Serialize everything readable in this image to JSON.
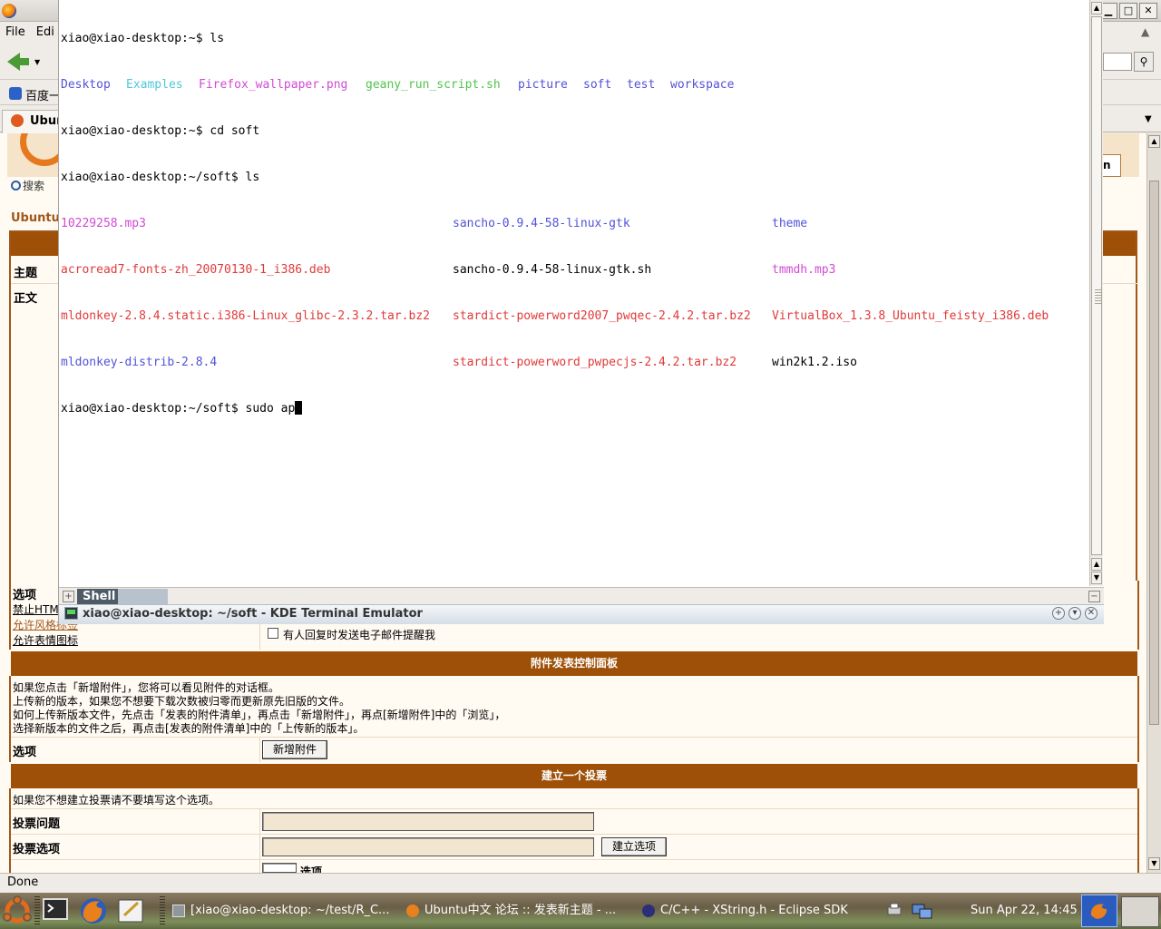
{
  "firefox": {
    "menu": {
      "file": "File",
      "edit": "Edi"
    },
    "bookmark": "百度一",
    "tab_title": "Ubun",
    "search_link": "搜索",
    "banner_tab": "n",
    "forum_title": "Ubuntu",
    "status": "Done",
    "form": {
      "subject_label": "主题",
      "body_label": "正文",
      "options_label": "选项",
      "opt_disable_html": "禁止HTM",
      "opt_allow_bbcode": "允许风格标签",
      "opt_allow_smilies": "允许表情图标",
      "notify_label": "有人回复时发送电子邮件提醒我",
      "attach_header": "附件发表控制面板",
      "attach_help": [
        "如果您点击「新增附件」，您将可以看见附件的对话框。",
        "上传新的版本，如果您不想要下载次数被归零而更新原先旧版的文件。",
        "如何上传新版本文件，先点击「发表的附件清单」，再点击「新增附件」，再点[新增附件]中的「浏览」，",
        "选择新版本的文件之后，再点击[发表的附件清单]中的「上传新的版本」。"
      ],
      "attach_options_label": "选项",
      "add_attachment_button": "新增附件",
      "poll_header": "建立一个投票",
      "poll_help": "如果您不想建立投票请不要填写这个选项。",
      "poll_question_label": "投票问题",
      "poll_option_label": "投票选项",
      "add_option_button": "建立选项",
      "poll_duration_suffix": "选项"
    }
  },
  "konsole": {
    "title": "xiao@xiao-desktop: ~/soft - KDE Terminal Emulator",
    "tab_label": "Shell",
    "terminal": {
      "prompt_home": "xiao@xiao-desktop:~$ ",
      "prompt_soft": "xiao@xiao-desktop:~/soft$ ",
      "cmd_ls": "ls",
      "cmd_cd": "cd soft",
      "cmd_partial": "sudo ap",
      "home_listing": [
        "Desktop",
        "Examples",
        "Firefox_wallpaper.png",
        "geany_run_script.sh",
        "picture",
        "soft",
        "test",
        "workspace"
      ],
      "soft_listing": {
        "col1": [
          "10229258.mp3",
          "acroread7-fonts-zh_20070130-1_i386.deb",
          "mldonkey-2.8.4.static.i386-Linux_glibc-2.3.2.tar.bz2",
          "mldonkey-distrib-2.8.4"
        ],
        "col2": [
          "sancho-0.9.4-58-linux-gtk",
          "sancho-0.9.4-58-linux-gtk.sh",
          "stardict-powerword2007_pwqec-2.4.2.tar.bz2",
          "stardict-powerword_pwpecjs-2.4.2.tar.bz2"
        ],
        "col3": [
          "theme",
          "tmmdh.mp3",
          "VirtualBox_1.3.8_Ubuntu_feisty_i386.deb",
          "win2k1.2.iso"
        ]
      }
    }
  },
  "taskbar": {
    "tasks": [
      "[xiao@xiao-desktop: ~/test/R_C...",
      "Ubuntu中文 论坛 :: 发表新主题 - ...",
      "C/C++ - XString.h - Eclipse SDK"
    ],
    "clock": "Sun Apr 22, 14:45"
  },
  "colors": {
    "forum_brown": "#9e5008",
    "term_dir": "#5252d8",
    "term_archive": "#e03a3a",
    "term_exec": "#52c44e",
    "term_media": "#d04ad4"
  }
}
